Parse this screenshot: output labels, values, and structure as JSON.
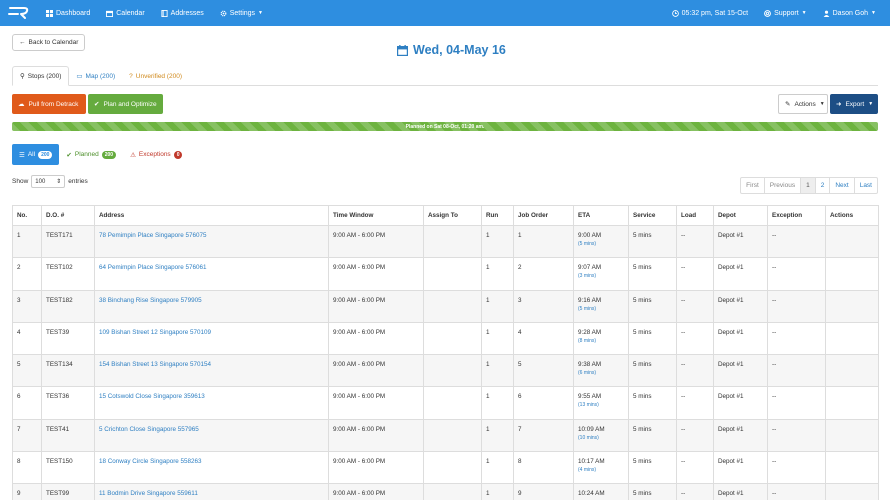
{
  "nav": {
    "items": [
      {
        "label": "Dashboard",
        "icon": "dashboard-icon"
      },
      {
        "label": "Calendar",
        "icon": "calendar-icon"
      },
      {
        "label": "Addresses",
        "icon": "book-icon"
      },
      {
        "label": "Settings",
        "icon": "gear-icon"
      }
    ],
    "clock": "05:32 pm, Sat 15-Oct",
    "support": "Support",
    "user": "Dason Goh"
  },
  "back_label": "Back to Calendar",
  "title": "Wed, 04-May 16",
  "tabs": {
    "stops": "Stops (200)",
    "map": "Map (200)",
    "unverified": "Unverified (200)"
  },
  "buttons": {
    "pull": "Pull from Detrack",
    "plan": "Plan and Optimize",
    "actions": "Actions",
    "export": "Export"
  },
  "progress": {
    "label": "Planned on Sat 08-Oct, 01:20 am.",
    "percent": 100
  },
  "filters": {
    "all": {
      "label": "All",
      "count": "200"
    },
    "planned": {
      "label": "Planned",
      "count": "200"
    },
    "exceptions": {
      "label": "Exceptions",
      "count": "0"
    }
  },
  "show": {
    "prefix": "Show",
    "value": "100",
    "suffix": "entries"
  },
  "pagination": [
    "First",
    "Previous",
    "1",
    "2",
    "Next",
    "Last"
  ],
  "table": {
    "headers": [
      "No.",
      "D.O. #",
      "Address",
      "Time Window",
      "Assign To",
      "Run",
      "Job Order",
      "ETA",
      "Service",
      "Load",
      "Depot",
      "Exception",
      "Actions"
    ],
    "rows": [
      {
        "no": "1",
        "do": "TEST171",
        "address": "78 Pemimpin Place Singapore 576075",
        "window": "9:00 AM - 6:00 PM",
        "assign": "",
        "run": "1",
        "order": "1",
        "eta": "9:00 AM",
        "eta_sub": "(5 mins)",
        "service": "5 mins",
        "load": "--",
        "depot": "Depot #1",
        "exception": "--",
        "actions": ""
      },
      {
        "no": "2",
        "do": "TEST102",
        "address": "64 Pemimpin Place Singapore 576061",
        "window": "9:00 AM - 6:00 PM",
        "assign": "",
        "run": "1",
        "order": "2",
        "eta": "9:07 AM",
        "eta_sub": "(3 mins)",
        "service": "5 mins",
        "load": "--",
        "depot": "Depot #1",
        "exception": "--",
        "actions": ""
      },
      {
        "no": "3",
        "do": "TEST182",
        "address": "38 Binchang Rise Singapore 579905",
        "window": "9:00 AM - 6:00 PM",
        "assign": "",
        "run": "1",
        "order": "3",
        "eta": "9:16 AM",
        "eta_sub": "(5 mins)",
        "service": "5 mins",
        "load": "--",
        "depot": "Depot #1",
        "exception": "--",
        "actions": ""
      },
      {
        "no": "4",
        "do": "TEST39",
        "address": "109 Bishan Street 12 Singapore 570109",
        "window": "9:00 AM - 6:00 PM",
        "assign": "",
        "run": "1",
        "order": "4",
        "eta": "9:28 AM",
        "eta_sub": "(8 mins)",
        "service": "5 mins",
        "load": "--",
        "depot": "Depot #1",
        "exception": "--",
        "actions": ""
      },
      {
        "no": "5",
        "do": "TEST134",
        "address": "154 Bishan Street 13 Singapore 570154",
        "window": "9:00 AM - 6:00 PM",
        "assign": "",
        "run": "1",
        "order": "5",
        "eta": "9:38 AM",
        "eta_sub": "(6 mins)",
        "service": "5 mins",
        "load": "--",
        "depot": "Depot #1",
        "exception": "--",
        "actions": ""
      },
      {
        "no": "6",
        "do": "TEST36",
        "address": "15 Cotswold Close Singapore 359613",
        "window": "9:00 AM - 6:00 PM",
        "assign": "",
        "run": "1",
        "order": "6",
        "eta": "9:55 AM",
        "eta_sub": "(13 mins)",
        "service": "5 mins",
        "load": "--",
        "depot": "Depot #1",
        "exception": "--",
        "actions": ""
      },
      {
        "no": "7",
        "do": "TEST41",
        "address": "5 Crichton Close Singapore 557965",
        "window": "9:00 AM - 6:00 PM",
        "assign": "",
        "run": "1",
        "order": "7",
        "eta": "10:09 AM",
        "eta_sub": "(10 mins)",
        "service": "5 mins",
        "load": "--",
        "depot": "Depot #1",
        "exception": "--",
        "actions": ""
      },
      {
        "no": "8",
        "do": "TEST150",
        "address": "18 Conway Circle Singapore 558263",
        "window": "9:00 AM - 6:00 PM",
        "assign": "",
        "run": "1",
        "order": "8",
        "eta": "10:17 AM",
        "eta_sub": "(4 mins)",
        "service": "5 mins",
        "load": "--",
        "depot": "Depot #1",
        "exception": "--",
        "actions": ""
      },
      {
        "no": "9",
        "do": "TEST99",
        "address": "11 Bodmin Drive Singapore 559611",
        "window": "9:00 AM - 6:00 PM",
        "assign": "",
        "run": "1",
        "order": "9",
        "eta": "10:24 AM",
        "eta_sub": "",
        "service": "5 mins",
        "load": "--",
        "depot": "Depot #1",
        "exception": "--",
        "actions": ""
      }
    ]
  },
  "colors": {
    "navbar": "#2e8ee0",
    "title": "#2e7fc2",
    "pull": "#e05a1a",
    "plan": "#65ab3e",
    "export": "#1d4e85",
    "progress": "#6db33f",
    "exception": "#c0392b"
  }
}
